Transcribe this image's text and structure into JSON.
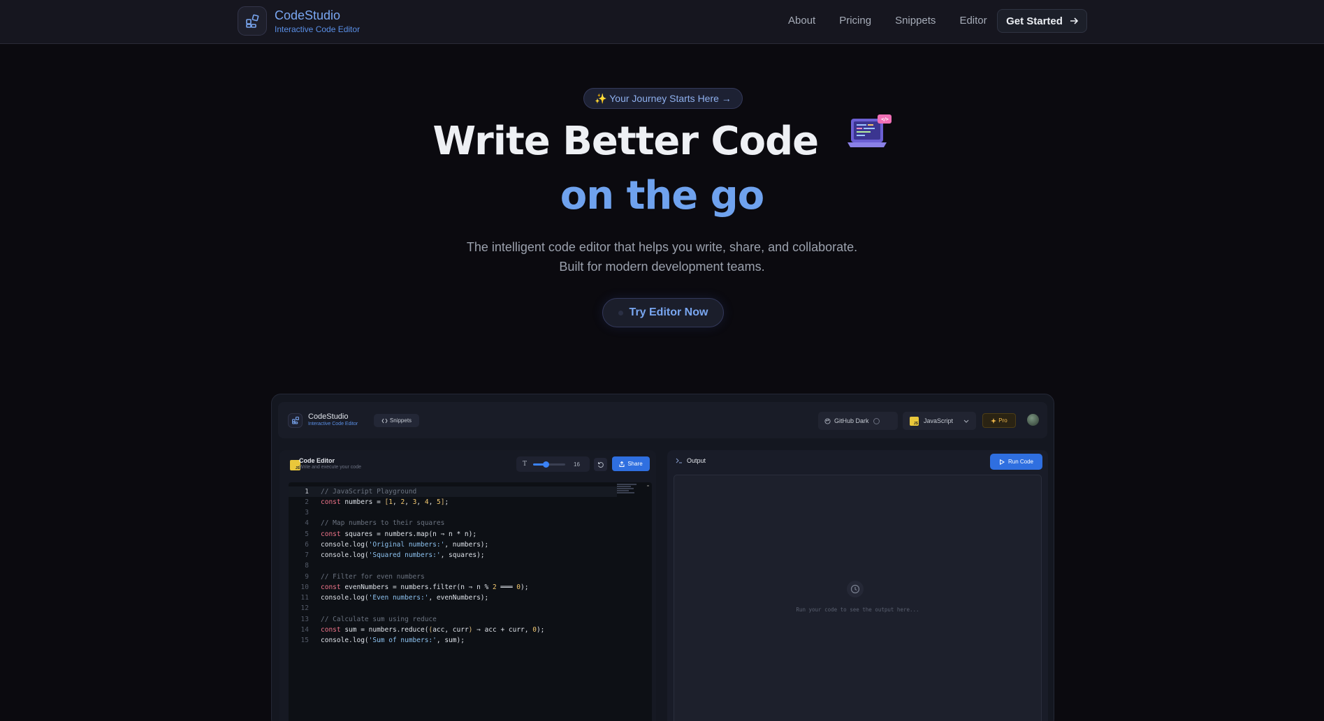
{
  "nav": {
    "brand_name": "CodeStudio",
    "brand_sub": "Interactive Code Editor",
    "links": [
      "About",
      "Pricing",
      "Snippets",
      "Editor"
    ],
    "cta": "Get Started"
  },
  "hero": {
    "badge": "✨ Your Journey Starts Here →",
    "title_line1": "Write Better Code",
    "title_line2": "on the go",
    "subtitle_line1": "The intelligent code editor that helps you write, share, and collaborate.",
    "subtitle_line2": "Built for modern development teams.",
    "try_button": "Try Editor Now"
  },
  "app": {
    "brand_name": "CodeStudio",
    "brand_sub": "Interactive Code Editor",
    "snippets": "Snippets",
    "theme": "GitHub Dark",
    "language": "JavaScript",
    "pro": "Pro",
    "editor": {
      "title": "Code Editor",
      "subtitle": "Write and execute your code",
      "font_size": "16",
      "share": "Share",
      "js_badge": "JS"
    },
    "output": {
      "title": "Output",
      "run": "Run Code",
      "hint": "Run your code to see the output here..."
    }
  },
  "colors": {
    "accent": "#6fa2ee",
    "primary_button": "#2f6fe0",
    "background": "#0b0a0f"
  },
  "code_lines": [
    "// JavaScript Playground",
    "const numbers = [1, 2, 3, 4, 5];",
    "",
    "// Map numbers to their squares",
    "const squares = numbers.map(n => n * n);",
    "console.log('Original numbers:', numbers);",
    "console.log('Squared numbers:', squares);",
    "",
    "// Filter for even numbers",
    "const evenNumbers = numbers.filter(n => n % 2 === 0);",
    "console.log('Even numbers:', evenNumbers);",
    "",
    "// Calculate sum using reduce",
    "const sum = numbers.reduce((acc, curr) => acc + curr, 0);",
    "console.log('Sum of numbers:', sum);"
  ]
}
